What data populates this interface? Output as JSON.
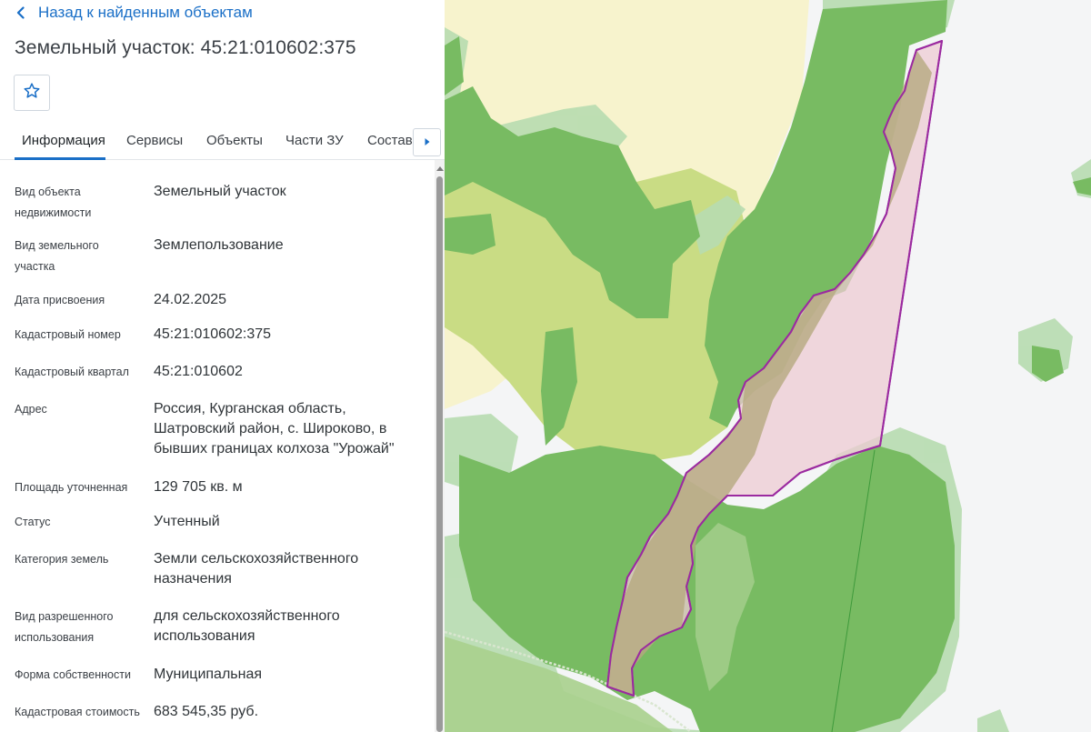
{
  "back_link": {
    "label": "Назад к найденным объектам",
    "icon": "chevron-left-icon"
  },
  "title": "Земельный участок: 45:21:010602:375",
  "favorite": {
    "icon": "star-icon"
  },
  "tabs": [
    {
      "label": "Информация",
      "active": true
    },
    {
      "label": "Сервисы",
      "active": false
    },
    {
      "label": "Объекты",
      "active": false
    },
    {
      "label": "Части ЗУ",
      "active": false
    },
    {
      "label": "Состав",
      "active": false
    }
  ],
  "tabs_next_icon": "caret-right-icon",
  "info": {
    "object_type": {
      "label": "Вид объекта недвижимости",
      "value": "Земельный участок"
    },
    "land_type": {
      "label": "Вид земельного участка",
      "value": "Землепользование"
    },
    "assign_date": {
      "label": "Дата присвоения",
      "value": "24.02.2025"
    },
    "cadastral_number": {
      "label": "Кадастровый номер",
      "value": "45:21:010602:375"
    },
    "cadastral_block": {
      "label": "Кадастровый квартал",
      "value": "45:21:010602"
    },
    "address": {
      "label": "Адрес",
      "value": "Россия, Курганская область, Шатровский район, с. Широково, в бывших границах колхоза \"Урожай\""
    },
    "area": {
      "label": "Площадь уточненная",
      "value": "129 705 кв. м"
    },
    "status": {
      "label": "Статус",
      "value": "Учтенный"
    },
    "category": {
      "label": "Категория земель",
      "value": "Земли сельскохозяйственного назначения"
    },
    "permitted_use": {
      "label": "Вид разрешенного использования",
      "value": "для сельскохозяйственного использования"
    },
    "ownership": {
      "label": "Форма собственности",
      "value": "Муниципальная"
    },
    "cadastral_value": {
      "label": "Кадастровая стоимость",
      "value": "683 545,35 руб."
    }
  },
  "colors": {
    "link": "#1a6fc7",
    "forest": "#78bb62",
    "forest_light": "#b7dcb0",
    "meadow": "#c9dc84",
    "field": "#f7f3cd",
    "parcel_fill": "#eecbd3",
    "parcel_border": "#9b2aa0"
  }
}
